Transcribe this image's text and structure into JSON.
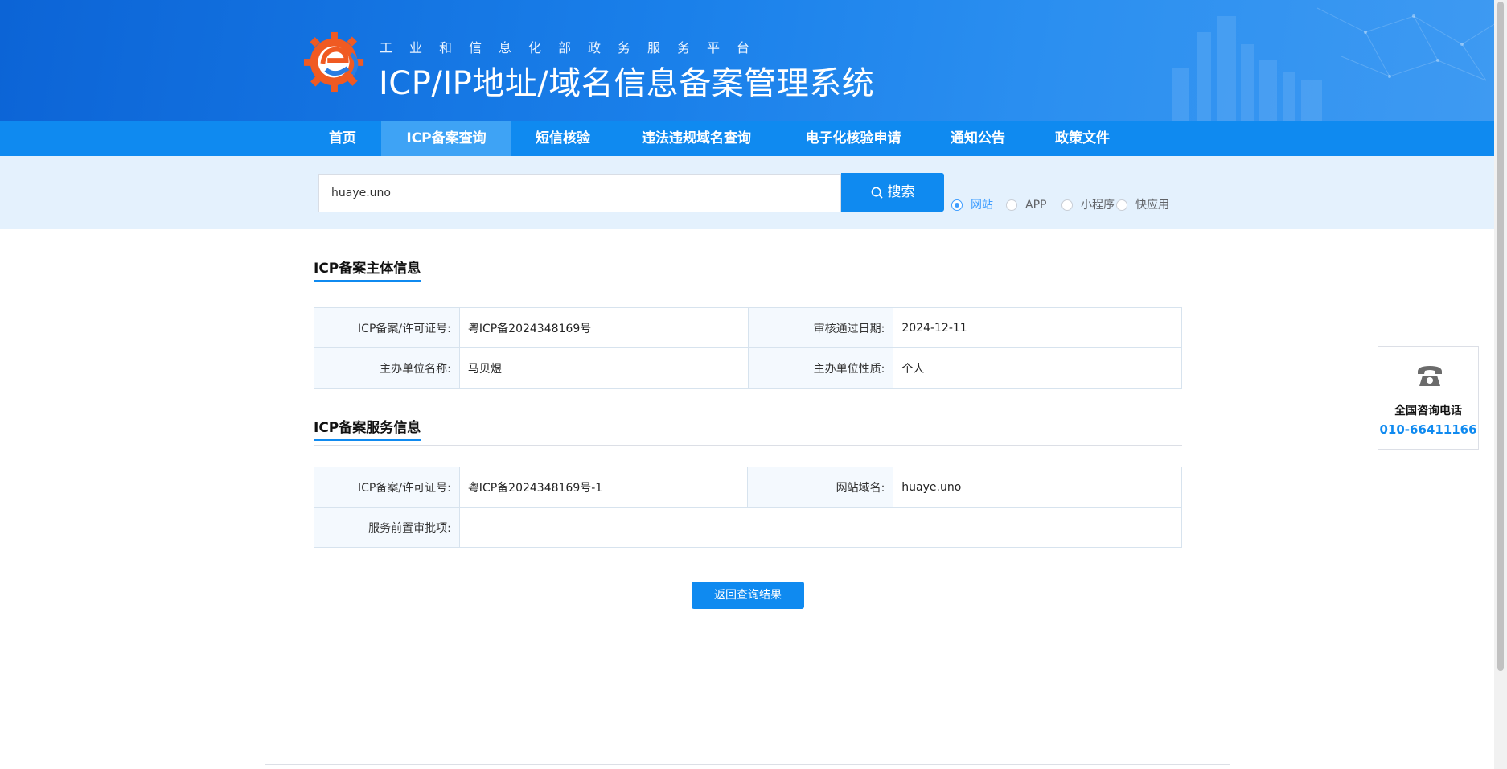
{
  "header": {
    "subtitle": "工业和信息化部政务服务平台",
    "title": "ICP/IP地址/域名信息备案管理系统"
  },
  "nav": {
    "items": [
      "首页",
      "ICP备案查询",
      "短信核验",
      "违法违规域名查询",
      "电子化核验申请",
      "通知公告",
      "政策文件"
    ],
    "active_index": 1
  },
  "search": {
    "value": "huaye.uno",
    "button_label": "搜索",
    "types": [
      "网站",
      "APP",
      "小程序",
      "快应用"
    ],
    "selected_type": "网站"
  },
  "subject_section": {
    "title": "ICP备案主体信息",
    "rows": [
      {
        "k1": "ICP备案/许可证号:",
        "v1": "粤ICP备2024348169号",
        "k2": "审核通过日期:",
        "v2": "2024-12-11"
      },
      {
        "k1": "主办单位名称:",
        "v1": "马贝煜",
        "k2": "主办单位性质:",
        "v2": "个人"
      }
    ]
  },
  "service_section": {
    "title": "ICP备案服务信息",
    "row1": {
      "k1": "ICP备案/许可证号:",
      "v1": "粤ICP备2024348169号-1",
      "k2": "网站域名:",
      "v2": "huaye.uno"
    },
    "row2": {
      "k1": "服务前置审批项:",
      "v1": ""
    }
  },
  "back_button": "返回查询结果",
  "contact": {
    "label": "全国咨询电话",
    "number": "010-66411166"
  },
  "colors": {
    "primary": "#0f8af0",
    "nav_active": "#3ea3f5",
    "logo_orange": "#f05a22"
  }
}
